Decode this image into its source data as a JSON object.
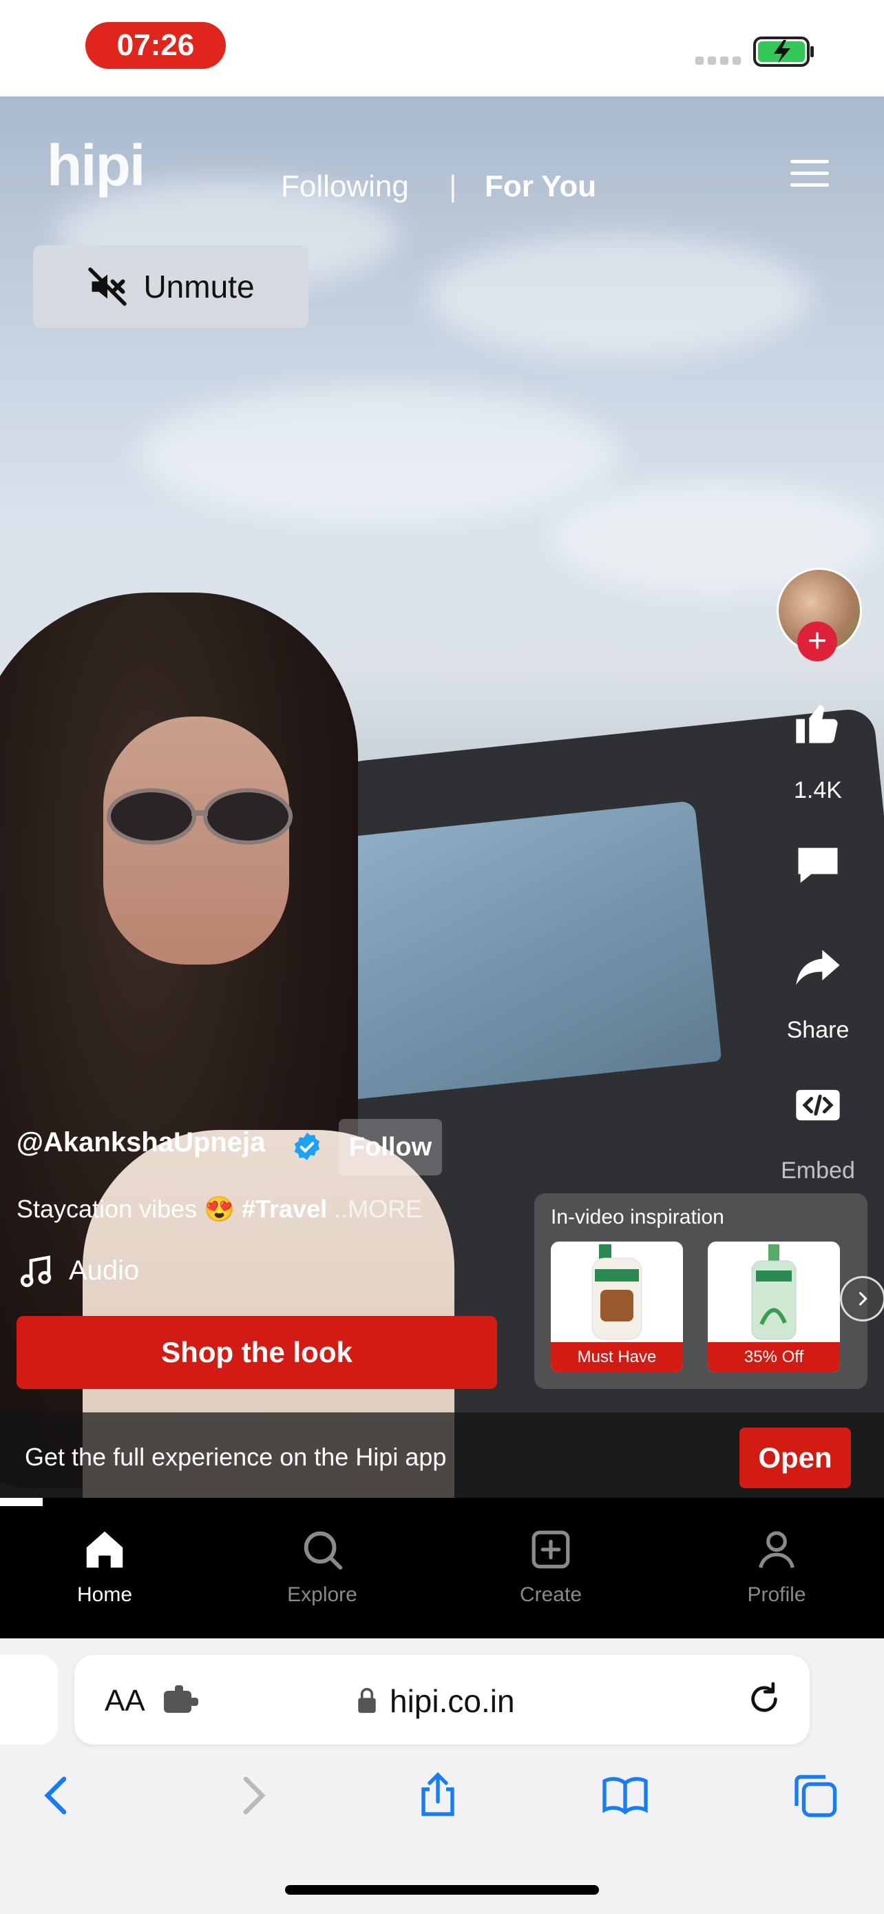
{
  "status_bar": {
    "time": "07:26"
  },
  "header": {
    "logo": "hipi",
    "tabs": [
      {
        "label": "Following",
        "active": false
      },
      {
        "label": "|",
        "active": false
      },
      {
        "label": "For You",
        "active": true
      }
    ],
    "menu_icon": "hamburger-menu-icon"
  },
  "unmute": {
    "label": "Unmute",
    "icon": "speaker-muted-icon"
  },
  "rail": {
    "like_count": "1.4K",
    "share_label": "Share",
    "embed_label": "Embed"
  },
  "post": {
    "username": "@AkankshaUpneja",
    "follow_label": "Follow",
    "caption_text": "Staycation vibes 😍 ",
    "caption_tag": "#Travel",
    "caption_more": " ..MORE",
    "audio_label": "Audio"
  },
  "shop": {
    "label": "Shop the look"
  },
  "inspiration": {
    "title": "In-video inspiration",
    "products": [
      {
        "badge": "Must Have"
      },
      {
        "badge": "35% Off"
      }
    ]
  },
  "app_banner": {
    "text": "Get the full experience on the Hipi app",
    "open_label": "Open"
  },
  "bottom_nav": [
    {
      "label": "Home",
      "icon": "home-icon",
      "active": true
    },
    {
      "label": "Explore",
      "icon": "search-icon",
      "active": false
    },
    {
      "label": "Create",
      "icon": "plus-square-icon",
      "active": false
    },
    {
      "label": "Profile",
      "icon": "user-icon",
      "active": false
    }
  ],
  "browser": {
    "aa": "AA",
    "url": "hipi.co.in"
  },
  "colors": {
    "accent": "#d21b12",
    "time_pill": "#e0251c",
    "battery": "#34c759",
    "safari_blue": "#1a7cf5"
  }
}
